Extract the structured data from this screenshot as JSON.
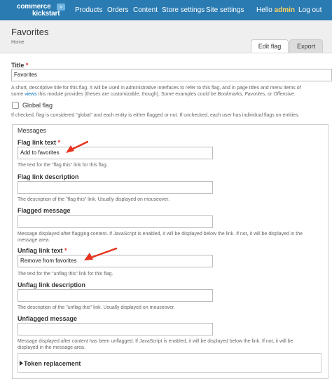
{
  "topbar": {
    "logo_line1": "commerce",
    "logo_line2": "kickstart",
    "logo_badge": "»",
    "nav": [
      "Products",
      "Orders",
      "Content",
      "Store settings",
      "Site settings"
    ],
    "greeting": "Hello",
    "user": "admin",
    "logout": "Log out"
  },
  "header": {
    "title": "Favorites",
    "breadcrumb": "Home",
    "tabs": [
      "Edit flag",
      "Export"
    ]
  },
  "form": {
    "title_label": "Title",
    "required_mark": "*",
    "title_value": "Favorites",
    "title_desc_1": "A short, descriptive title for this flag. It will be used in administrative interfaces to refer to this flag, and in page titles and menu items of",
    "title_desc_2a": "some ",
    "title_desc_link": "views",
    "title_desc_2b": " this module provides (theses are customizable, though). Some examples could be ",
    "title_desc_2c": "Bookmarks, Favorites,",
    "title_desc_2d": " or ",
    "title_desc_2e": "Offensive",
    "title_desc_2f": ".",
    "global_label": "Global flag",
    "global_desc": "If checked, flag is considered \"global\" and each entity is either flagged or not. If unchecked, each user has individual flags on entities."
  },
  "messages": {
    "legend": "Messages",
    "fields": [
      {
        "label": "Flag link text",
        "required": true,
        "value": "Add to favorites",
        "desc": [
          "The text for the \"flag this\" link for this flag."
        ]
      },
      {
        "label": "Flag link description",
        "required": false,
        "value": "",
        "desc": [
          "The description of the \"flag this\" link. Usually displayed on mouseover."
        ]
      },
      {
        "label": "Flagged message",
        "required": false,
        "value": "",
        "desc": [
          "Message displayed after flagging content. If JavaScript is enabled, it will be displayed below the link. If not, it will be displayed in the",
          "message area."
        ]
      },
      {
        "label": "Unflag link text",
        "required": true,
        "value": "Remove from favorites",
        "desc": [
          "The text for the \"unflag this\" link for this flag."
        ]
      },
      {
        "label": "Unflag link description",
        "required": false,
        "value": "",
        "desc": [
          "The description of the \"unflag this\" link. Usually displayed on mouseover."
        ]
      },
      {
        "label": "Unflagged message",
        "required": false,
        "value": "",
        "desc": [
          "Message displayed after content has been unflagged. If JavaScript is enabled, it will be displayed below the link. If not, it will be",
          "displayed in the message area."
        ]
      }
    ],
    "token_label": "Token replacement"
  },
  "colors": {
    "topbar": "#2a7bb2",
    "accent_user": "#ffd35b",
    "required": "#e0302d",
    "annotation_arrow": "#e8321e"
  }
}
